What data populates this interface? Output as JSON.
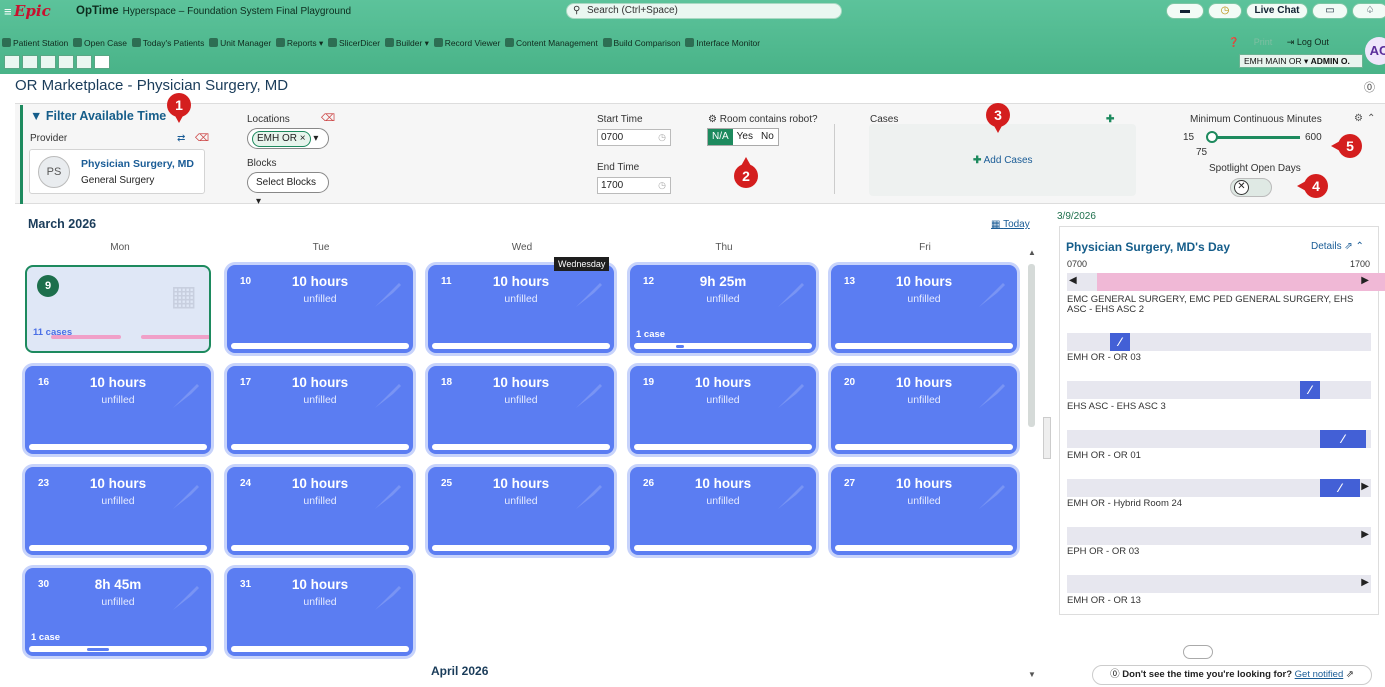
{
  "header": {
    "logo": "Epic",
    "app_name": "OpTime",
    "env": "Hyperspace – Foundation System Final Playground",
    "search_placeholder": "Search (Ctrl+Space)",
    "live_chat": "Live Chat",
    "toolbar": [
      "Patient Station",
      "Open Case",
      "Today's Patients",
      "Unit Manager",
      "Reports ▾",
      "SlicerDicer",
      "Builder ▾",
      "Record Viewer",
      "Content Management",
      "Build Comparison",
      "Interface Monitor"
    ],
    "print_label": "Print",
    "logout_label": "Log Out",
    "dept": "EMH MAIN OR ▾",
    "user": "ADMIN O.",
    "avatar": "AC"
  },
  "page": {
    "title": "OR Marketplace - Physician Surgery, MD"
  },
  "filter": {
    "title": "▼ Filter Available Time",
    "provider_label": "Provider",
    "provider_initials": "PS",
    "provider_name": "Physician Surgery, MD",
    "provider_specialty": "General Surgery",
    "locations_label": "Locations",
    "location_value": "EMH OR ×",
    "blocks_label": "Blocks",
    "blocks_value": "Select Blocks ▾",
    "start_label": "Start Time",
    "start_value": "0700",
    "end_label": "End Time",
    "end_value": "1700",
    "robot_label": "Room contains robot?",
    "robot_options": [
      "N/A",
      "Yes",
      "No"
    ],
    "cases_label": "Cases",
    "add_cases": "Add Cases",
    "min_label": "Minimum Continuous Minutes",
    "min_low": "15",
    "min_high": "600",
    "min_value": "75",
    "spotlight_label": "Spotlight Open Days"
  },
  "badges": [
    "1",
    "2",
    "3",
    "4",
    "5"
  ],
  "calendar": {
    "month": "March 2026",
    "today": "Today",
    "days": [
      "Mon",
      "Tue",
      "Wed",
      "Thu",
      "Fri"
    ],
    "tooltip": "Wednesday",
    "next_month": "April 2026",
    "cells": [
      {
        "day": "9",
        "hours": "",
        "unfilled": "",
        "cases": "11 cases",
        "today": true
      },
      {
        "day": "10",
        "hours": "10 hours",
        "unfilled": "unfilled",
        "cases": ""
      },
      {
        "day": "11",
        "hours": "10 hours",
        "unfilled": "unfilled",
        "cases": ""
      },
      {
        "day": "12",
        "hours": "9h 25m",
        "unfilled": "unfilled",
        "cases": "1 case"
      },
      {
        "day": "13",
        "hours": "10 hours",
        "unfilled": "unfilled",
        "cases": ""
      },
      {
        "day": "16",
        "hours": "10 hours",
        "unfilled": "unfilled",
        "cases": ""
      },
      {
        "day": "17",
        "hours": "10 hours",
        "unfilled": "unfilled",
        "cases": ""
      },
      {
        "day": "18",
        "hours": "10 hours",
        "unfilled": "unfilled",
        "cases": ""
      },
      {
        "day": "19",
        "hours": "10 hours",
        "unfilled": "unfilled",
        "cases": ""
      },
      {
        "day": "20",
        "hours": "10 hours",
        "unfilled": "unfilled",
        "cases": ""
      },
      {
        "day": "23",
        "hours": "10 hours",
        "unfilled": "unfilled",
        "cases": ""
      },
      {
        "day": "24",
        "hours": "10 hours",
        "unfilled": "unfilled",
        "cases": ""
      },
      {
        "day": "25",
        "hours": "10 hours",
        "unfilled": "unfilled",
        "cases": ""
      },
      {
        "day": "26",
        "hours": "10 hours",
        "unfilled": "unfilled",
        "cases": ""
      },
      {
        "day": "27",
        "hours": "10 hours",
        "unfilled": "unfilled",
        "cases": ""
      },
      {
        "day": "30",
        "hours": "8h 45m",
        "unfilled": "unfilled",
        "cases": "1 case"
      },
      {
        "day": "31",
        "hours": "10 hours",
        "unfilled": "unfilled",
        "cases": ""
      }
    ]
  },
  "day_panel": {
    "date": "3/9/2026",
    "title": "Physician Surgery, MD's Day",
    "details": "Details",
    "start": "0700",
    "end": "1700",
    "rows": [
      "EMC GENERAL SURGERY, EMC PED GENERAL SURGERY, EHS ASC - EHS ASC 2",
      "EMH OR - OR 03",
      "EHS ASC - EHS ASC 3",
      "EMH OR - OR 01",
      "EMH OR - Hybrid Room 24",
      "EPH OR - OR 03",
      "EMH OR - OR 13"
    ],
    "notify_text": "Don't see the time you're looking for?",
    "notify_link": "Get notified"
  }
}
